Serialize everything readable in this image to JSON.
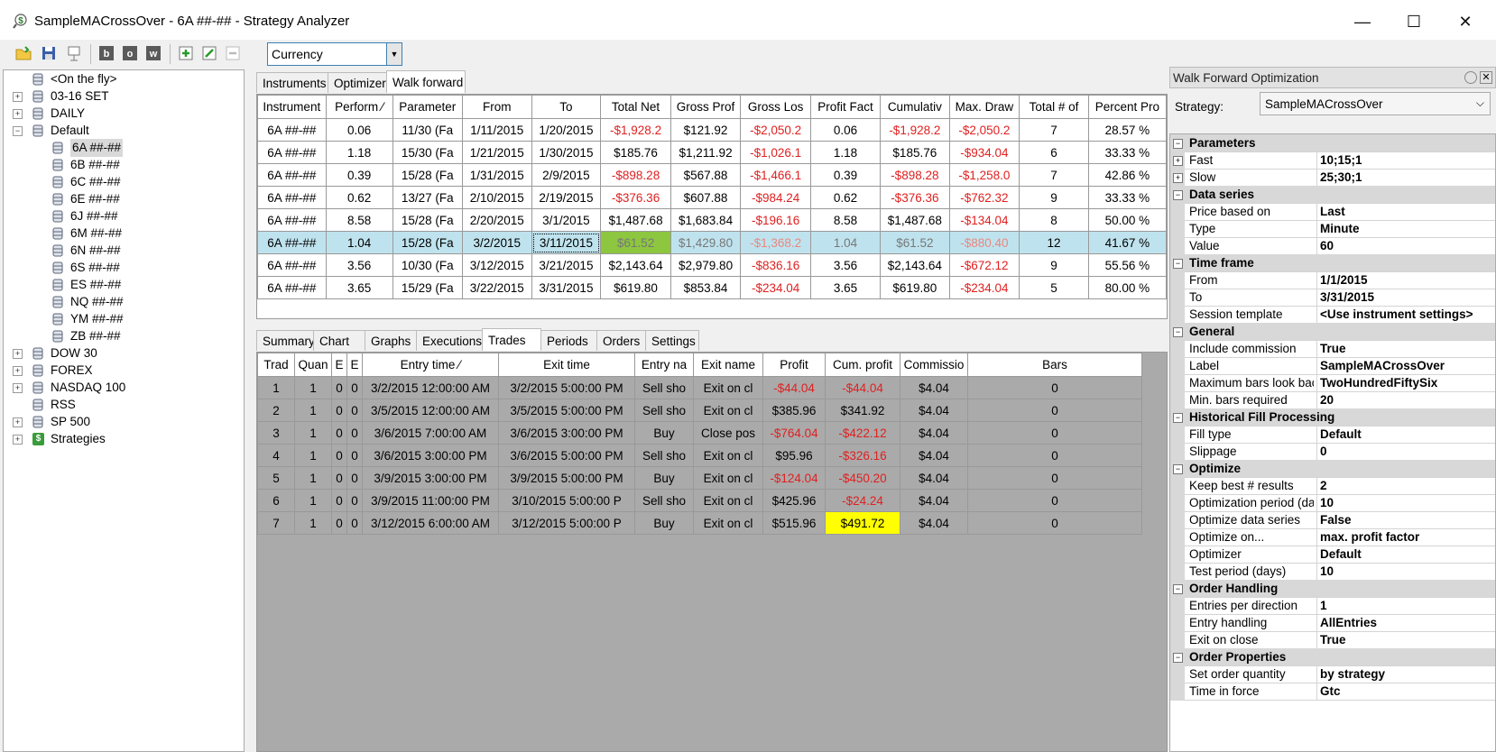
{
  "window": {
    "title": "SampleMACrossOver - 6A ##-## - Strategy Analyzer"
  },
  "toolbar": {
    "currency_value": "Currency"
  },
  "tree": {
    "items": [
      {
        "label": "<On the fly>",
        "expandable": false,
        "indent": 1
      },
      {
        "label": "03-16 SET",
        "expandable": true,
        "sign": "+",
        "indent": 0
      },
      {
        "label": "DAILY",
        "expandable": true,
        "sign": "+",
        "indent": 0
      },
      {
        "label": "Default",
        "expandable": true,
        "sign": "−",
        "indent": 0
      },
      {
        "label": "6A ##-##",
        "expandable": false,
        "indent": 2,
        "selected": true
      },
      {
        "label": "6B ##-##",
        "expandable": false,
        "indent": 2
      },
      {
        "label": "6C ##-##",
        "expandable": false,
        "indent": 2
      },
      {
        "label": "6E ##-##",
        "expandable": false,
        "indent": 2
      },
      {
        "label": "6J ##-##",
        "expandable": false,
        "indent": 2
      },
      {
        "label": "6M ##-##",
        "expandable": false,
        "indent": 2
      },
      {
        "label": "6N ##-##",
        "expandable": false,
        "indent": 2
      },
      {
        "label": "6S ##-##",
        "expandable": false,
        "indent": 2
      },
      {
        "label": "ES ##-##",
        "expandable": false,
        "indent": 2
      },
      {
        "label": "NQ ##-##",
        "expandable": false,
        "indent": 2
      },
      {
        "label": "YM ##-##",
        "expandable": false,
        "indent": 2
      },
      {
        "label": "ZB ##-##",
        "expandable": false,
        "indent": 2
      },
      {
        "label": "DOW 30",
        "expandable": true,
        "sign": "+",
        "indent": 0
      },
      {
        "label": "FOREX",
        "expandable": true,
        "sign": "+",
        "indent": 0
      },
      {
        "label": "NASDAQ 100",
        "expandable": true,
        "sign": "+",
        "indent": 0
      },
      {
        "label": "RSS",
        "expandable": false,
        "indent": 1
      },
      {
        "label": "SP 500",
        "expandable": true,
        "sign": "+",
        "indent": 0
      },
      {
        "label": "Strategies",
        "expandable": true,
        "sign": "+",
        "indent": 0,
        "icon": "dollar"
      }
    ]
  },
  "top_tabs": [
    "Instruments",
    "Optimizer",
    "Walk forward"
  ],
  "top_tabs_active": 2,
  "walk_forward": {
    "columns": [
      "Instrument",
      "Perform",
      "Parameter",
      "From",
      "To",
      "Total Net",
      "Gross Prof",
      "Gross Los",
      "Profit Fact",
      "Cumulativ",
      "Max. Draw",
      "Total # of",
      "Percent Pro"
    ],
    "sort_column": 1,
    "rows": [
      [
        "6A ##-##",
        "0.06",
        "11/30 (Fa",
        "1/11/2015",
        "1/20/2015",
        "-$1,928.2",
        "$121.92",
        "-$2,050.2",
        "0.06",
        "-$1,928.2",
        "-$2,050.2",
        "7",
        "28.57 %"
      ],
      [
        "6A ##-##",
        "1.18",
        "15/30 (Fa",
        "1/21/2015",
        "1/30/2015",
        "$185.76",
        "$1,211.92",
        "-$1,026.1",
        "1.18",
        "$185.76",
        "-$934.04",
        "6",
        "33.33 %"
      ],
      [
        "6A ##-##",
        "0.39",
        "15/28 (Fa",
        "1/31/2015",
        "2/9/2015",
        "-$898.28",
        "$567.88",
        "-$1,466.1",
        "0.39",
        "-$898.28",
        "-$1,258.0",
        "7",
        "42.86 %"
      ],
      [
        "6A ##-##",
        "0.62",
        "13/27 (Fa",
        "2/10/2015",
        "2/19/2015",
        "-$376.36",
        "$607.88",
        "-$984.24",
        "0.62",
        "-$376.36",
        "-$762.32",
        "9",
        "33.33 %"
      ],
      [
        "6A ##-##",
        "8.58",
        "15/28 (Fa",
        "2/20/2015",
        "3/1/2015",
        "$1,487.68",
        "$1,683.84",
        "-$196.16",
        "8.58",
        "$1,487.68",
        "-$134.04",
        "8",
        "50.00 %"
      ],
      [
        "6A ##-##",
        "1.04",
        "15/28 (Fa",
        "3/2/2015",
        "3/11/2015",
        "$61.52",
        "$1,429.80",
        "-$1,368.2",
        "1.04",
        "$61.52",
        "-$880.40",
        "12",
        "41.67 %"
      ],
      [
        "6A ##-##",
        "3.56",
        "10/30 (Fa",
        "3/12/2015",
        "3/21/2015",
        "$2,143.64",
        "$2,979.80",
        "-$836.16",
        "3.56",
        "$2,143.64",
        "-$672.12",
        "9",
        "55.56 %"
      ],
      [
        "6A ##-##",
        "3.65",
        "15/29 (Fa",
        "3/22/2015",
        "3/31/2015",
        "$619.80",
        "$853.84",
        "-$234.04",
        "3.65",
        "$619.80",
        "-$234.04",
        "5",
        "80.00 %"
      ]
    ],
    "highlighted_row": 5
  },
  "bottom_tabs": [
    "Summary",
    "Chart",
    "Graphs",
    "Executions",
    "Trades",
    "Periods",
    "Orders",
    "Settings"
  ],
  "bottom_tabs_active": 4,
  "trades": {
    "columns": [
      "Trad",
      "Quan",
      "E",
      "E",
      "Entry time",
      "Exit time",
      "Entry na",
      "Exit name",
      "Profit",
      "Cum. profit",
      "Commissio",
      "Bars"
    ],
    "sort_column": 4,
    "rows": [
      [
        "1",
        "1",
        "0",
        "0",
        "3/2/2015 12:00:00 AM",
        "3/2/2015 5:00:00 PM",
        "Sell sho",
        "Exit on cl",
        "-$44.04",
        "-$44.04",
        "$4.04",
        "0"
      ],
      [
        "2",
        "1",
        "0",
        "0",
        "3/5/2015 12:00:00 AM",
        "3/5/2015 5:00:00 PM",
        "Sell sho",
        "Exit on cl",
        "$385.96",
        "$341.92",
        "$4.04",
        "0"
      ],
      [
        "3",
        "1",
        "0",
        "0",
        "3/6/2015 7:00:00 AM",
        "3/6/2015 3:00:00 PM",
        "Buy",
        "Close pos",
        "-$764.04",
        "-$422.12",
        "$4.04",
        "0"
      ],
      [
        "4",
        "1",
        "0",
        "0",
        "3/6/2015 3:00:00 PM",
        "3/6/2015 5:00:00 PM",
        "Sell sho",
        "Exit on cl",
        "$95.96",
        "-$326.16",
        "$4.04",
        "0"
      ],
      [
        "5",
        "1",
        "0",
        "0",
        "3/9/2015 3:00:00 PM",
        "3/9/2015 5:00:00 PM",
        "Buy",
        "Exit on cl",
        "-$124.04",
        "-$450.20",
        "$4.04",
        "0"
      ],
      [
        "6",
        "1",
        "0",
        "0",
        "3/9/2015 11:00:00 PM",
        "3/10/2015 5:00:00 P",
        "Sell sho",
        "Exit on cl",
        "$425.96",
        "-$24.24",
        "$4.04",
        "0"
      ],
      [
        "7",
        "1",
        "0",
        "0",
        "3/12/2015 6:00:00 AM",
        "3/12/2015 5:00:00 P",
        "Buy",
        "Exit on cl",
        "$515.96",
        "$491.72",
        "$4.04",
        "0"
      ]
    ]
  },
  "right_panel": {
    "title": "Walk Forward Optimization",
    "strategy_label": "Strategy:",
    "strategy_value": "SampleMACrossOver",
    "properties": [
      {
        "type": "cat",
        "label": "Parameters"
      },
      {
        "type": "prop",
        "label": "Fast",
        "value": "10;15;1",
        "expandable": true
      },
      {
        "type": "prop",
        "label": "Slow",
        "value": "25;30;1",
        "expandable": true
      },
      {
        "type": "cat",
        "label": "Data series"
      },
      {
        "type": "prop",
        "label": "Price based on",
        "value": "Last"
      },
      {
        "type": "prop",
        "label": "Type",
        "value": "Minute"
      },
      {
        "type": "prop",
        "label": "Value",
        "value": "60"
      },
      {
        "type": "cat",
        "label": "Time frame"
      },
      {
        "type": "prop",
        "label": "From",
        "value": "1/1/2015"
      },
      {
        "type": "prop",
        "label": "To",
        "value": "3/31/2015"
      },
      {
        "type": "prop",
        "label": "Session template",
        "value": "<Use instrument settings>"
      },
      {
        "type": "cat",
        "label": "General"
      },
      {
        "type": "prop",
        "label": "Include commission",
        "value": "True"
      },
      {
        "type": "prop",
        "label": "Label",
        "value": "SampleMACrossOver"
      },
      {
        "type": "prop",
        "label": "Maximum bars look bac",
        "value": "TwoHundredFiftySix"
      },
      {
        "type": "prop",
        "label": "Min. bars required",
        "value": "20"
      },
      {
        "type": "cat",
        "label": "Historical Fill Processing"
      },
      {
        "type": "prop",
        "label": "Fill type",
        "value": "Default"
      },
      {
        "type": "prop",
        "label": "Slippage",
        "value": "0"
      },
      {
        "type": "cat",
        "label": "Optimize"
      },
      {
        "type": "prop",
        "label": "Keep best # results",
        "value": "2"
      },
      {
        "type": "prop",
        "label": "Optimization period (da",
        "value": "10"
      },
      {
        "type": "prop",
        "label": "Optimize data series",
        "value": "False"
      },
      {
        "type": "prop",
        "label": "Optimize on...",
        "value": "max. profit factor"
      },
      {
        "type": "prop",
        "label": "Optimizer",
        "value": "Default"
      },
      {
        "type": "prop",
        "label": "Test period (days)",
        "value": "10"
      },
      {
        "type": "cat",
        "label": "Order Handling"
      },
      {
        "type": "prop",
        "label": "Entries per direction",
        "value": "1"
      },
      {
        "type": "prop",
        "label": "Entry handling",
        "value": "AllEntries"
      },
      {
        "type": "prop",
        "label": "Exit on close",
        "value": "True"
      },
      {
        "type": "cat",
        "label": "Order Properties"
      },
      {
        "type": "prop",
        "label": "Set order quantity",
        "value": "by strategy"
      },
      {
        "type": "prop",
        "label": "Time in force",
        "value": "Gtc"
      }
    ]
  },
  "colors": {
    "negative": "#e02020",
    "highlight_row": "#bfe3ee",
    "green_cell": "#8dc63f",
    "yellow_cell": "#ffff00"
  }
}
